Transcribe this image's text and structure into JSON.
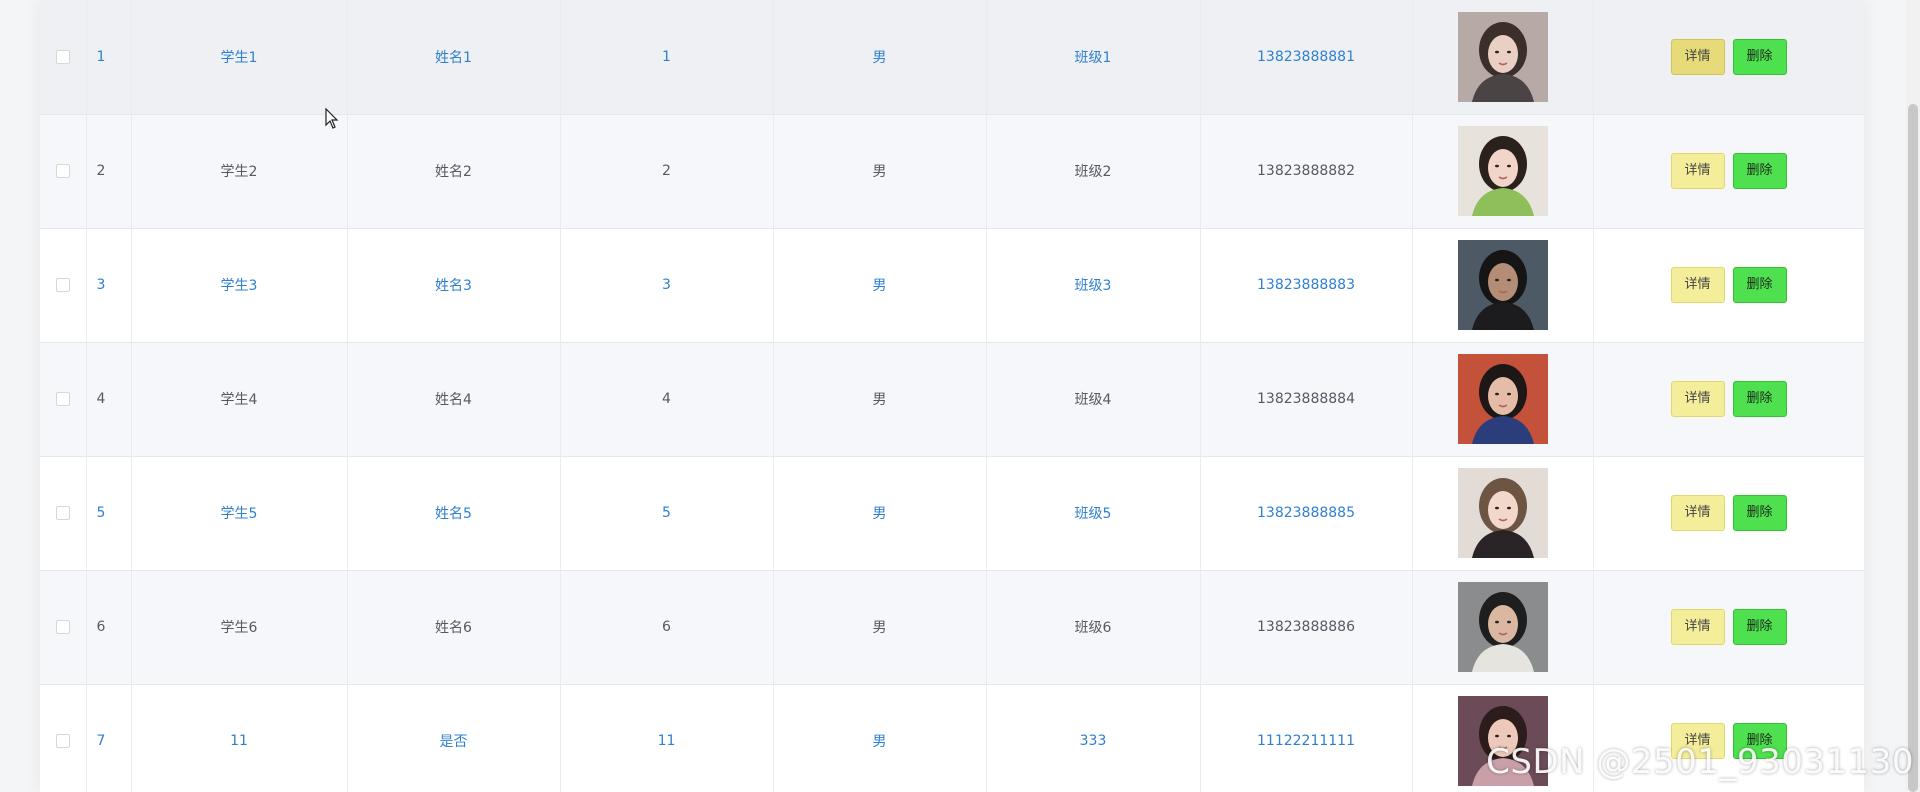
{
  "table": {
    "rows": [
      {
        "idx": "1",
        "xuehao": "学生1",
        "name": "姓名1",
        "age": "1",
        "sex": "男",
        "class": "班级1",
        "phone": "13823888881",
        "avatar": "photo-woman-scarf",
        "style": "blue",
        "hover": true
      },
      {
        "idx": "2",
        "xuehao": "学生2",
        "name": "姓名2",
        "age": "2",
        "sex": "男",
        "class": "班级2",
        "phone": "13823888882",
        "avatar": "photo-woman-green-sweater",
        "style": "plain",
        "hover": false
      },
      {
        "idx": "3",
        "xuehao": "学生3",
        "name": "姓名3",
        "age": "3",
        "sex": "男",
        "class": "班级3",
        "phone": "13823888883",
        "avatar": "photo-man-dark",
        "style": "blue",
        "hover": false
      },
      {
        "idx": "4",
        "xuehao": "学生4",
        "name": "姓名4",
        "age": "4",
        "sex": "男",
        "class": "班级4",
        "phone": "13823888884",
        "avatar": "photo-woman-orange-bg",
        "style": "plain",
        "hover": false
      },
      {
        "idx": "5",
        "xuehao": "学生5",
        "name": "姓名5",
        "age": "5",
        "sex": "男",
        "class": "班级5",
        "phone": "13823888885",
        "avatar": "photo-woman-choker",
        "style": "blue",
        "hover": false
      },
      {
        "idx": "6",
        "xuehao": "学生6",
        "name": "姓名6",
        "age": "6",
        "sex": "男",
        "class": "班级6",
        "phone": "13823888886",
        "avatar": "photo-man-full-body",
        "style": "plain",
        "hover": false
      },
      {
        "idx": "7",
        "xuehao": "11",
        "name": "是否",
        "age": "11",
        "sex": "男",
        "class": "333",
        "phone": "11122211111",
        "avatar": "photo-woman-long-hair",
        "style": "blue",
        "hover": false
      }
    ],
    "actions": {
      "detail_label": "详情",
      "delete_label": "删除"
    }
  },
  "watermark": "CSDN @2501_93031130",
  "colors": {
    "link_blue": "#2f80d1",
    "text_gray": "#555a62",
    "detail_button": "#f4ed9a",
    "delete_button": "#4fe04f",
    "alt_row": "#f5f7fb"
  }
}
